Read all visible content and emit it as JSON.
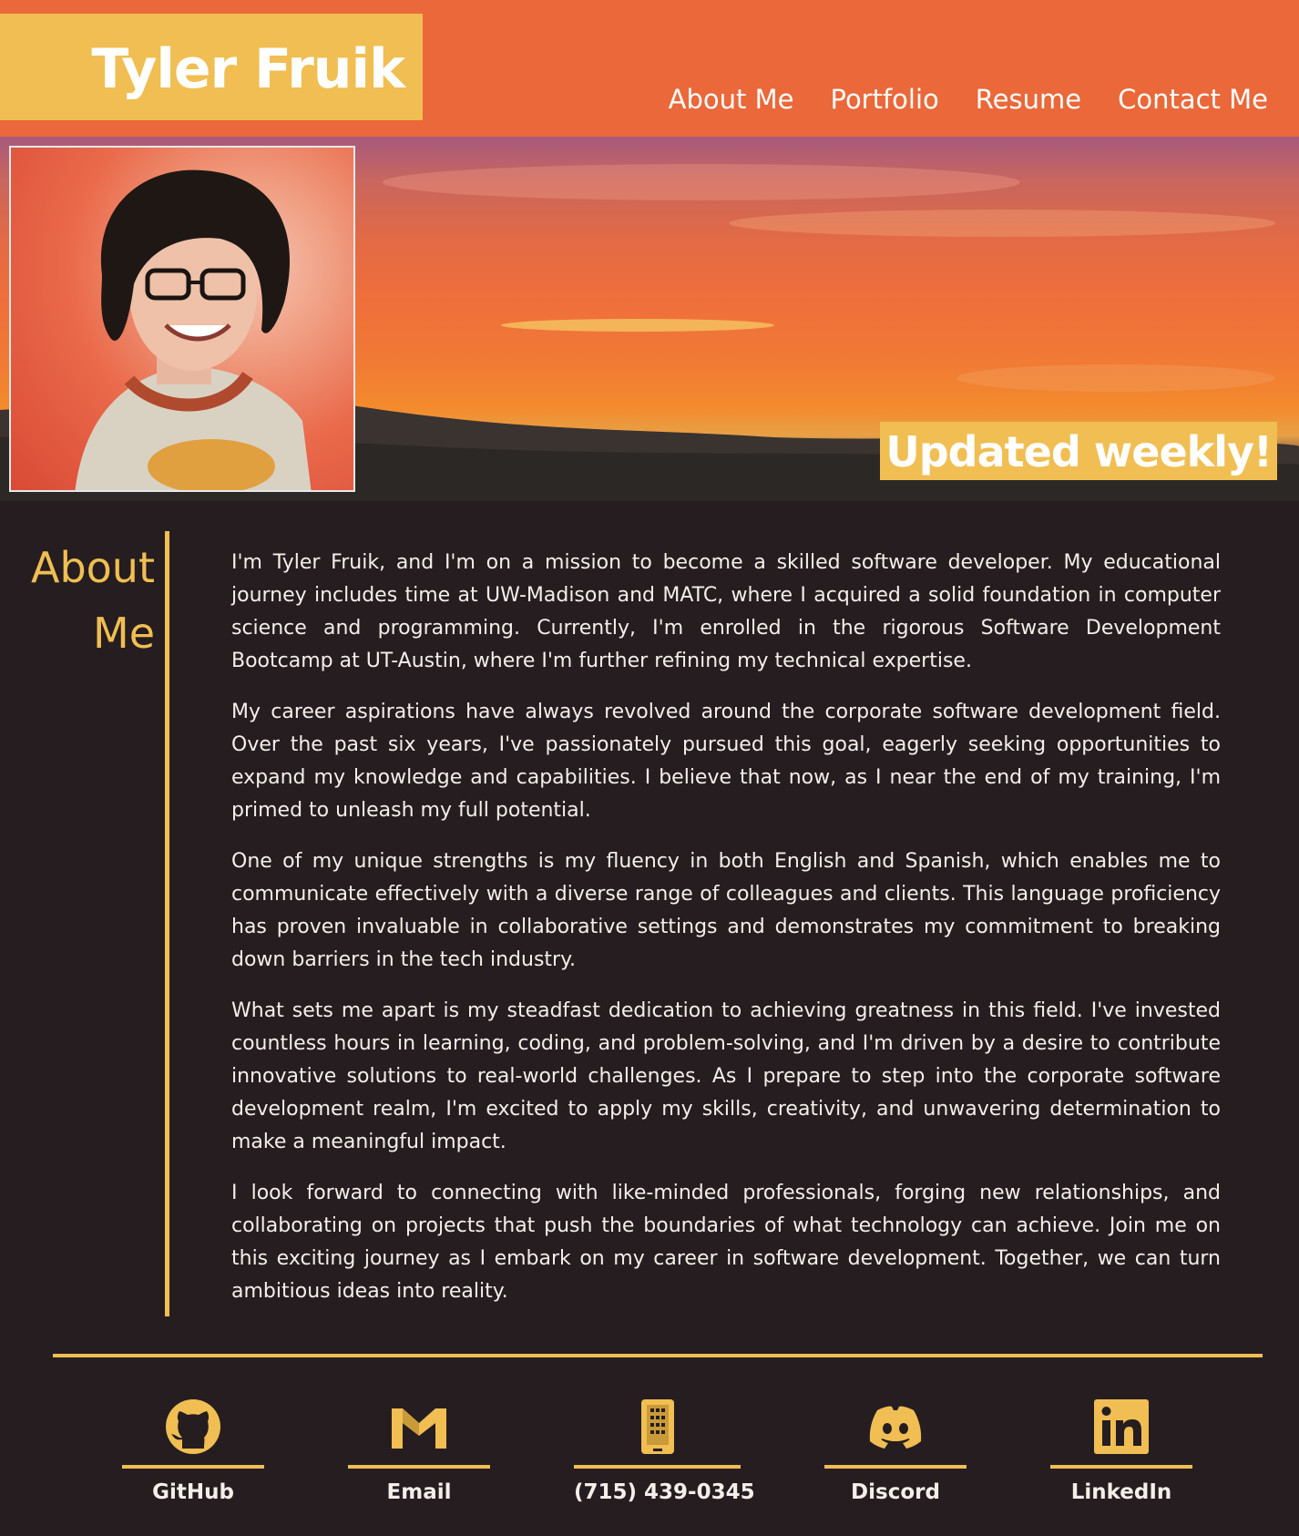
{
  "header": {
    "name": "Tyler Fruik",
    "nav": [
      "About Me",
      "Portfolio",
      "Resume",
      "Contact Me"
    ]
  },
  "hero": {
    "badge": "Updated weekly!"
  },
  "about": {
    "title_line1": "About",
    "title_line2": "Me",
    "paragraphs": [
      "I'm Tyler Fruik, and I'm on a mission to become a skilled software developer. My educational journey includes time at UW-Madison and MATC, where I acquired a solid foundation in computer science and programming. Currently, I'm enrolled in the rigorous Software Development Bootcamp at UT-Austin, where I'm further refining my technical expertise.",
      "My career aspirations have always revolved around the corporate software development field. Over the past six years, I've passionately pursued this goal, eagerly seeking opportunities to expand my knowledge and capabilities. I believe that now, as I near the end of my training, I'm primed to unleash my full potential.",
      "One of my unique strengths is my fluency in both English and Spanish, which enables me to communicate effectively with a diverse range of colleagues and clients. This language proficiency has proven invaluable in collaborative settings and demonstrates my commitment to breaking down barriers in the tech industry.",
      "What sets me apart is my steadfast dedication to achieving greatness in this field. I've invested countless hours in learning, coding, and problem-solving, and I'm driven by a desire to contribute innovative solutions to real-world challenges. As I prepare to step into the corporate software development realm, I'm excited to apply my skills, creativity, and unwavering determination to make a meaningful impact.",
      "I look forward to connecting with like-minded professionals, forging new relationships, and collaborating on projects that push the boundaries of what technology can achieve. Join me on this exciting journey as I embark on my career in software development. Together, we can turn ambitious ideas into reality."
    ]
  },
  "footer": {
    "links": [
      {
        "label": "GitHub",
        "icon": "github-icon"
      },
      {
        "label": "Email",
        "icon": "gmail-icon"
      },
      {
        "label": "(715) 439-0345",
        "icon": "phone-icon"
      },
      {
        "label": "Discord",
        "icon": "discord-icon"
      },
      {
        "label": "LinkedIn",
        "icon": "linkedin-icon"
      }
    ]
  },
  "colors": {
    "header_bg": "#ea6839",
    "accent": "#f0be52",
    "page_bg": "#251d20",
    "text": "#f4efe9"
  }
}
